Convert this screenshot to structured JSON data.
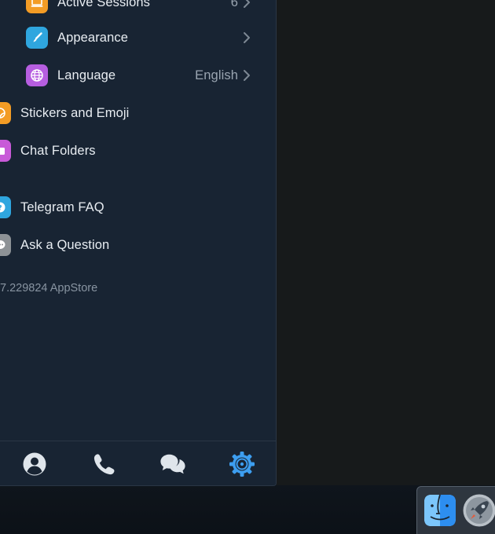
{
  "settings": {
    "items": [
      {
        "label": "Active Sessions",
        "value": "6",
        "icon": "sessions-icon",
        "color": "#f39c25"
      },
      {
        "label": "Appearance",
        "value": "",
        "icon": "brush-icon",
        "color": "#2fa6df"
      },
      {
        "label": "Language",
        "value": "English",
        "icon": "globe-icon",
        "color": "#b65ee0"
      },
      {
        "label": "Stickers and Emoji",
        "value": "",
        "icon": "sticker-icon",
        "color": "#f39c25"
      },
      {
        "label": "Chat Folders",
        "value": "",
        "icon": "folder-icon",
        "color": "#c85ad8"
      },
      {
        "label": "Telegram FAQ",
        "value": "",
        "icon": "faq-icon",
        "color": "#2fa6df"
      },
      {
        "label": "Ask a Question",
        "value": "",
        "icon": "chat-bubble-icon",
        "color": "#8d9296"
      }
    ],
    "version": "7.229824 AppStore"
  },
  "tabbar": {
    "tabs": [
      {
        "name": "contacts",
        "icon": "person-icon"
      },
      {
        "name": "calls",
        "icon": "phone-icon"
      },
      {
        "name": "chats",
        "icon": "chats-icon"
      },
      {
        "name": "settings",
        "icon": "gear-icon",
        "active": true
      }
    ],
    "active_color": "#3d9ef0",
    "inactive_color": "#dfe5eb"
  },
  "dock": {
    "items": [
      {
        "name": "finder",
        "icon": "finder-icon"
      },
      {
        "name": "launchpad",
        "icon": "rocket-icon"
      }
    ]
  }
}
